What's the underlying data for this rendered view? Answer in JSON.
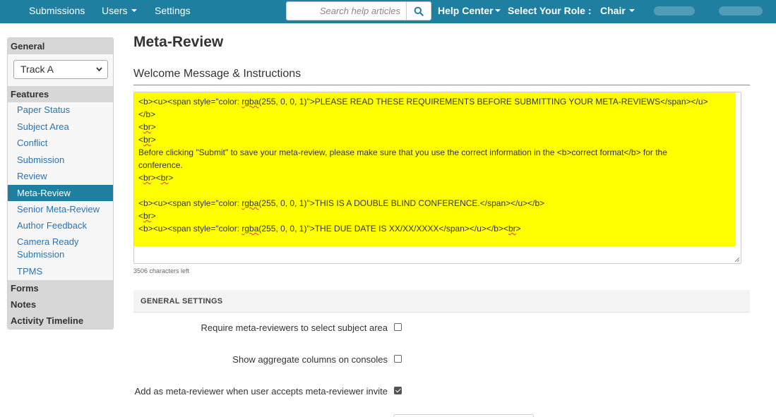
{
  "topnav": {
    "submissions": "Submissions",
    "users": "Users",
    "settings": "Settings",
    "search_placeholder": "Search help articles",
    "help_center": "Help Center",
    "select_role_label": "Select Your Role :",
    "role": "Chair",
    "icons": {
      "search": "search-icon",
      "dropdown": "caret-down-icon"
    },
    "bar_color": "#1f7fa0"
  },
  "sidebar": {
    "general": "General",
    "track_select": "Track A",
    "features": "Features",
    "items": [
      "Paper Status",
      "Subject Area",
      "Conflict",
      "Submission",
      "Review",
      "Meta-Review",
      "Senior Meta-Review",
      "Author Feedback",
      "Camera Ready Submission",
      "TPMS"
    ],
    "active_item": "Meta-Review",
    "forms": "Forms",
    "notes": "Notes",
    "activity_timeline": "Activity Timeline"
  },
  "main": {
    "title": "Meta-Review",
    "section_title": "Welcome Message & Instructions",
    "editor_lines": [
      "<b><u><span style=\"color: rgba(255, 0, 0, 1)\">PLEASE READ THESE REQUIREMENTS BEFORE SUBMITTING YOUR META-REVIEWS</span></u>",
      "</b>",
      "<br>",
      "<br>",
      "Before clicking \"Submit\" to save your meta-review, please make sure that you use the correct information in the <b>correct format</b> for the",
      "conference.",
      "<br><br>",
      "",
      "<b><u><span style=\"color: rgba(255, 0, 0, 1)\">THIS IS A DOUBLE BLIND CONFERENCE.</span></u></b>",
      "<br>",
      "<b><u><span style=\"color: rgba(255, 0, 0, 1)\">THE DUE DATE IS XX/XX/XXXX</span></u></b><br>"
    ],
    "highlight_color": "#ffff00",
    "chars_left": "3506 characters left",
    "general_settings_header": "GENERAL SETTINGS",
    "settings": [
      {
        "label": "Require meta-reviewers to select subject area",
        "checked": false
      },
      {
        "label": "Show aggregate columns on consoles",
        "checked": false
      },
      {
        "label": "Add as meta-reviewer when user accepts meta-reviewer invite",
        "checked": true
      }
    ]
  }
}
